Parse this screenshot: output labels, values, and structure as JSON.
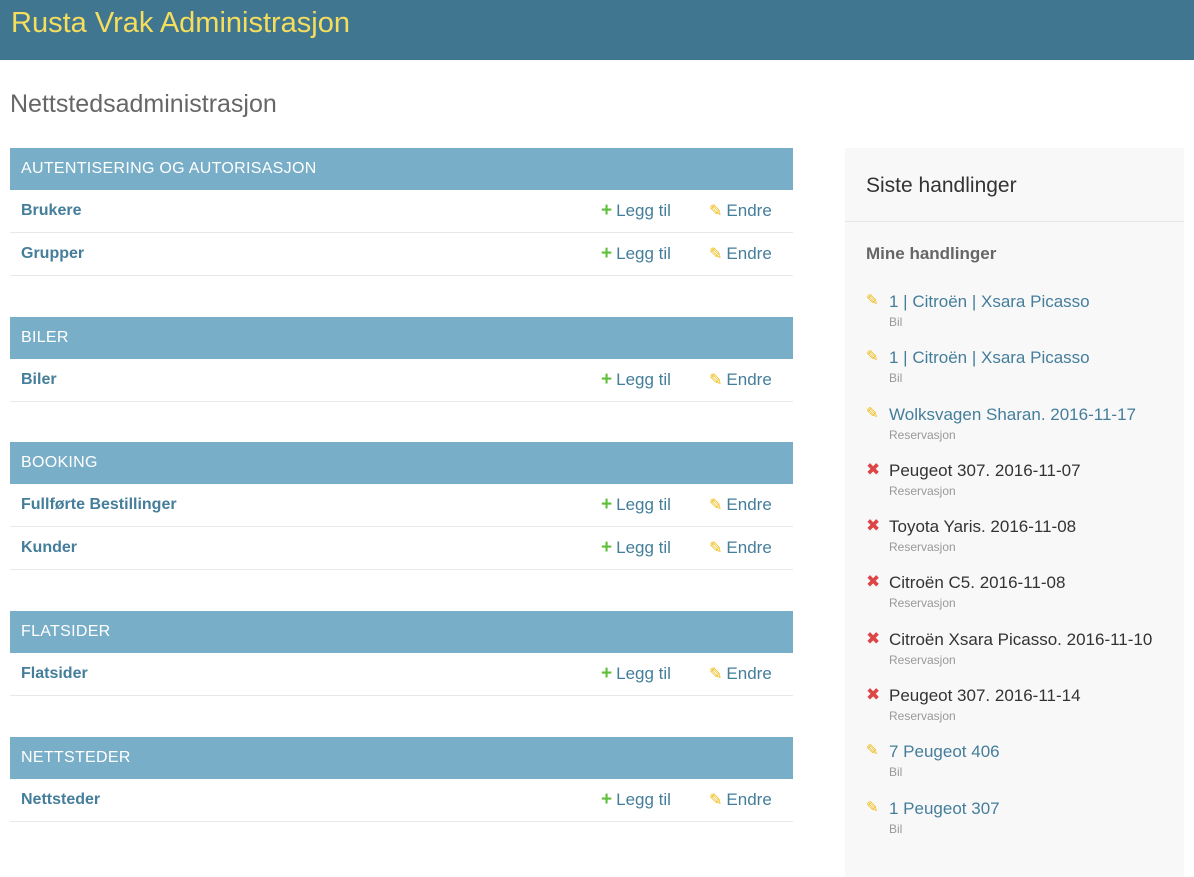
{
  "header": {
    "site_name": "Rusta Vrak Administrasjon"
  },
  "page": {
    "title": "Nettstedsadministrasjon"
  },
  "modules": [
    {
      "caption": "AUTENTISERING OG AUTORISASJON",
      "models": [
        {
          "name": "Brukere",
          "add": "Legg til",
          "change": "Endre"
        },
        {
          "name": "Grupper",
          "add": "Legg til",
          "change": "Endre"
        }
      ]
    },
    {
      "caption": "BILER",
      "models": [
        {
          "name": "Biler",
          "add": "Legg til",
          "change": "Endre"
        }
      ]
    },
    {
      "caption": "BOOKING",
      "models": [
        {
          "name": "Fullførte Bestillinger",
          "add": "Legg til",
          "change": "Endre"
        },
        {
          "name": "Kunder",
          "add": "Legg til",
          "change": "Endre"
        }
      ]
    },
    {
      "caption": "FLATSIDER",
      "models": [
        {
          "name": "Flatsider",
          "add": "Legg til",
          "change": "Endre"
        }
      ]
    },
    {
      "caption": "NETTSTEDER",
      "models": [
        {
          "name": "Nettsteder",
          "add": "Legg til",
          "change": "Endre"
        }
      ]
    }
  ],
  "icons": {
    "add": "+",
    "change": "✎",
    "delete": "✖"
  },
  "sidebar": {
    "title": "Siste handlinger",
    "subtitle": "Mine handlinger",
    "actions": [
      {
        "kind": "change",
        "icon": "pencil-icon",
        "label": "1 | Citroën | Xsara Picasso",
        "type": "Bil"
      },
      {
        "kind": "change",
        "icon": "pencil-icon",
        "label": "1 | Citroën | Xsara Picasso",
        "type": "Bil"
      },
      {
        "kind": "change",
        "icon": "pencil-icon",
        "label": "Wolksvagen Sharan. 2016-11-17",
        "type": "Reservasjon"
      },
      {
        "kind": "delete",
        "icon": "delete-icon",
        "label": "Peugeot 307. 2016-11-07",
        "type": "Reservasjon"
      },
      {
        "kind": "delete",
        "icon": "delete-icon",
        "label": "Toyota Yaris. 2016-11-08",
        "type": "Reservasjon"
      },
      {
        "kind": "delete",
        "icon": "delete-icon",
        "label": "Citroën C5. 2016-11-08",
        "type": "Reservasjon"
      },
      {
        "kind": "delete",
        "icon": "delete-icon",
        "label": "Citroën Xsara Picasso. 2016-11-10",
        "type": "Reservasjon"
      },
      {
        "kind": "delete",
        "icon": "delete-icon",
        "label": "Peugeot 307. 2016-11-14",
        "type": "Reservasjon"
      },
      {
        "kind": "change",
        "icon": "pencil-icon",
        "label": "7 Peugeot 406",
        "type": "Bil"
      },
      {
        "kind": "change",
        "icon": "pencil-icon",
        "label": "1 Peugeot 307",
        "type": "Bil"
      }
    ]
  },
  "colors": {
    "header_bg": "#417690",
    "site_name": "#f5dd5d",
    "caption_bg": "#79aec8",
    "link": "#447e9b",
    "add_icon": "#5fbf3b",
    "change_icon": "#efb80b",
    "delete_icon": "#dd4646"
  }
}
